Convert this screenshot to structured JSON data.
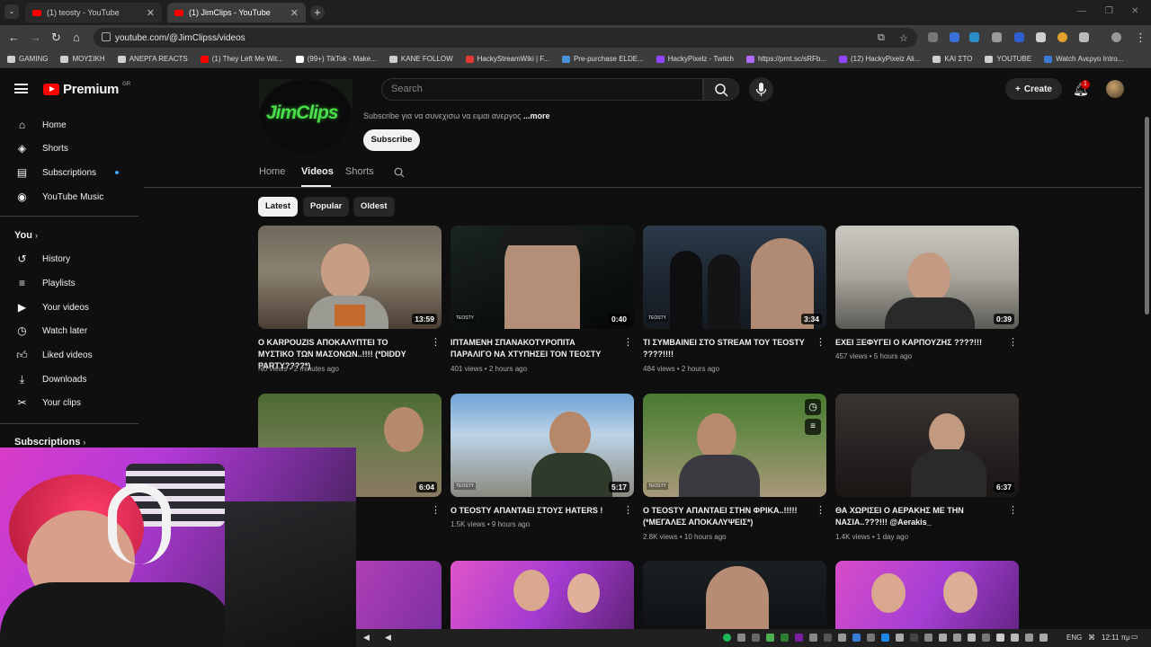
{
  "browser": {
    "tabs": [
      {
        "title": "(1) teosty - YouTube",
        "active": false
      },
      {
        "title": "(1) JimClips - YouTube",
        "active": true
      }
    ],
    "url": "youtube.com/@JimClipss/videos",
    "bookmarks": [
      {
        "label": "GAMING",
        "color": "#cfcfcf"
      },
      {
        "label": "ΜΟΥΣΙΚΗ",
        "color": "#cfcfcf"
      },
      {
        "label": "ΑΝΕΡΓΑ REACTS",
        "color": "#cfcfcf"
      },
      {
        "label": "(1) They Left Me Wit...",
        "color": "#ff0000"
      },
      {
        "label": "(99+) TikTok - Make...",
        "color": "#ffffff"
      },
      {
        "label": "KANE FOLLOW",
        "color": "#cfcfcf"
      },
      {
        "label": "HackyStreamWiki | F...",
        "color": "#e53935"
      },
      {
        "label": "Pre-purchase ELDE...",
        "color": "#4a90d9"
      },
      {
        "label": "HackyPixelz - Twitch",
        "color": "#9146ff"
      },
      {
        "label": "https://prnt.sc/sRFb...",
        "color": "#b36bff"
      },
      {
        "label": "(12) HackyPixelz Ali...",
        "color": "#9146ff"
      },
      {
        "label": "ΚΑΙ ΣΤΟ",
        "color": "#cfcfcf"
      },
      {
        "label": "YOUTUBE",
        "color": "#cfcfcf"
      },
      {
        "label": "Watch Ανεργο Intro...",
        "color": "#3a7bd5"
      }
    ]
  },
  "header": {
    "logo_text": "Premium",
    "country": "GR",
    "search_placeholder": "Search",
    "create_label": "Create",
    "notification_count": "1"
  },
  "sidebar": {
    "main": [
      {
        "label": "Home",
        "icon": "home-icon"
      },
      {
        "label": "Shorts",
        "icon": "shorts-icon"
      },
      {
        "label": "Subscriptions",
        "icon": "subscriptions-icon"
      },
      {
        "label": "YouTube Music",
        "icon": "music-icon"
      }
    ],
    "you_heading": "You",
    "you": [
      {
        "label": "History",
        "icon": "history-icon"
      },
      {
        "label": "Playlists",
        "icon": "playlists-icon"
      },
      {
        "label": "Your videos",
        "icon": "your-videos-icon"
      },
      {
        "label": "Watch later",
        "icon": "watch-later-icon"
      },
      {
        "label": "Liked videos",
        "icon": "like-icon"
      },
      {
        "label": "Downloads",
        "icon": "download-icon"
      },
      {
        "label": "Your clips",
        "icon": "clips-icon"
      }
    ],
    "subscriptions_heading": "Subscriptions"
  },
  "channel": {
    "logo_text": "JimClips",
    "description": "Subscribe για να συνεχισω να ειμαι ανεργος",
    "more_label": "...more",
    "subscribe_label": "Subscribe",
    "tabs": [
      "Home",
      "Videos",
      "Shorts"
    ],
    "active_tab": "Videos"
  },
  "filters": [
    {
      "label": "Latest",
      "active": true
    },
    {
      "label": "Popular",
      "active": false
    },
    {
      "label": "Oldest",
      "active": false
    }
  ],
  "videos": [
    {
      "title": "Ο KARPOUZIS ΑΠΟΚΑΛΥΠΤΕΙ ΤΟ ΜΥΣΤΙΚΟ ΤΩΝ ΜΑΣΟΝΩΝ..!!!! (*DIDDY PARTY????*)",
      "duration": "13:59",
      "meta": "No views • 2 minutes ago"
    },
    {
      "title": "ΙΠΤΑΜΕΝΗ ΣΠΑΝΑΚΟΤΥΡΟΠΙΤΑ ΠΑΡΑΛΙΓΟ ΝΑ ΧΤΥΠΗΣΕΙ ΤΟΝ ΤΕΟΣΤΥ",
      "duration": "0:40",
      "meta": "401 views • 2 hours ago"
    },
    {
      "title": "ΤΙ ΣΥΜΒΑΙΝΕΙ ΣΤΟ STREAM ΤΟΥ TEOSTY ????!!!!",
      "duration": "3:34",
      "meta": "484 views • 2 hours ago"
    },
    {
      "title": "ΕΧΕΙ ΞΕΦΥΓΕΙ Ο ΚΑΡΠΟΥΖΗΣ ????!!!",
      "duration": "0:39",
      "meta": "457 views • 5 hours ago"
    },
    {
      "title": "...ICK???",
      "duration": "6:04",
      "meta": ""
    },
    {
      "title": "Ο TEOSTY ΑΠΑΝΤΑΕΙ ΣΤΟΥΣ HATERS !",
      "duration": "5:17",
      "meta": "1.5K views • 9 hours ago"
    },
    {
      "title": "Ο TEOSTY ΑΠΑΝΤΑΕΙ ΣΤΗΝ ΦΡΙΚΑ..!!!!! (*ΜΕΓΑΛΕΣ ΑΠΟΚΑΛΥΨΕΙΣ*)",
      "duration": "",
      "meta": "2.8K views • 10 hours ago"
    },
    {
      "title": "ΘΑ ΧΩΡΙΣΕΙ Ο ΑΕΡΑΚΗΣ ΜΕ ΤΗΝ ΝΑΣΙΑ..???!!! @Aerakis_",
      "duration": "6:37",
      "meta": "1.4K views • 1 day ago"
    }
  ],
  "taskbar": {
    "language": "ENG",
    "time": "12:11 πμ"
  }
}
